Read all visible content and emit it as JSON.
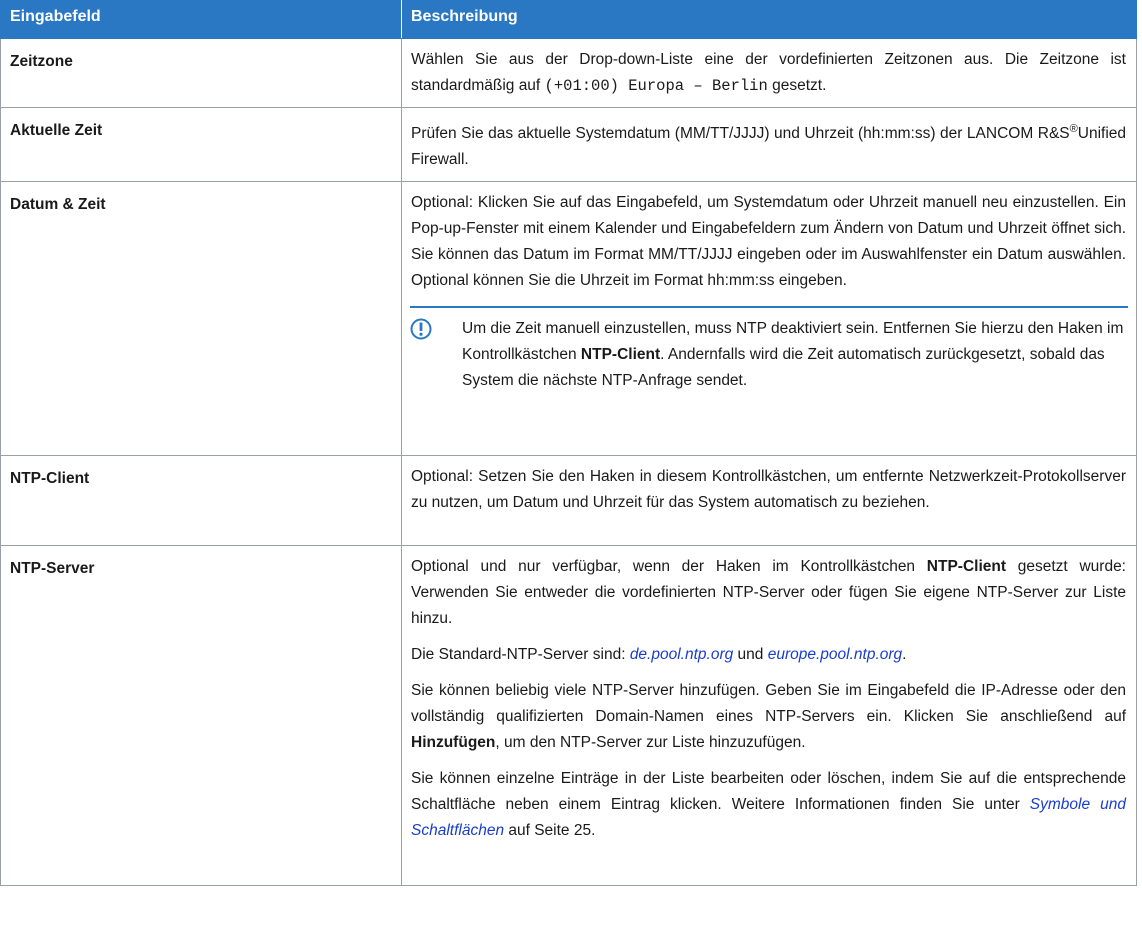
{
  "header": {
    "col1": "Eingabefeld",
    "col2": "Beschreibung"
  },
  "rows": [
    {
      "field": "Zeitzone",
      "p1_pre": "Wählen Sie aus der Drop-down-Liste eine der vordefinierten Zeitzonen aus. Die Zeitzone ist standardmäßig auf ",
      "p1_code": "(+01:00) Europa – Berlin",
      "p1_post": " gesetzt."
    },
    {
      "field": "Aktuelle Zeit",
      "p1_pre": "Prüfen Sie das aktuelle Systemdatum (MM/TT/JJJJ) und Uhrzeit (hh:mm:ss) der LANCOM R&S",
      "p1_sup": "®",
      "p1_post": "Unified Firewall."
    },
    {
      "field": "Datum & Zeit",
      "p1": "Optional: Klicken Sie auf das Eingabefeld, um Systemdatum oder Uhrzeit manuell neu einzustellen. Ein Pop-up-Fenster mit einem Kalender und Eingabefeldern zum Ändern von Datum und Uhrzeit öffnet sich. Sie können das Datum im Format MM/TT/JJJJ eingeben oder im Auswahlfenster ein Datum auswählen. Optional können Sie die Uhrzeit im Format hh:mm:ss eingeben.",
      "note_pre": "Um die Zeit manuell einzustellen, muss NTP deaktiviert sein. Entfernen Sie hierzu den Haken im Kontrollkästchen ",
      "note_bold": "NTP-Client",
      "note_post": ". Andernfalls wird die Zeit automatisch zurückgesetzt, sobald das System die nächste NTP-Anfrage sendet."
    },
    {
      "field": "NTP-Client",
      "p1": "Optional: Setzen Sie den Haken in diesem Kontrollkästchen, um entfernte Netzwerkzeit-Protokollserver zu nutzen, um Datum und Uhrzeit für das System automatisch zu beziehen."
    },
    {
      "field": "NTP-Server",
      "p1_pre": "Optional und nur verfügbar, wenn der Haken im Kontrollkästchen ",
      "p1_bold": "NTP-Client",
      "p1_post": " gesetzt wurde: Verwenden Sie entweder die vordefinierten NTP-Server oder fügen Sie eigene NTP-Server zur Liste hinzu.",
      "p2_pre": "Die Standard-NTP-Server sind: ",
      "p2_link1": "de.pool.ntp.org",
      "p2_mid": " und ",
      "p2_link2": "europe.pool.ntp.org",
      "p2_post": ".",
      "p3_pre": "Sie können beliebig viele NTP-Server hinzufügen. Geben Sie im Eingabefeld die IP-Adresse oder den vollständig qualifizierten Domain-Namen eines NTP-Servers ein. Klicken Sie anschließend auf ",
      "p3_bold": "Hinzufügen",
      "p3_post": ", um den NTP-Server zur Liste hinzuzufügen.",
      "p4_pre": "Sie können einzelne Einträge in der Liste bearbeiten oder löschen, indem Sie auf die entsprechende Schaltfläche neben einem Eintrag klicken. Weitere Informationen finden Sie unter ",
      "p4_link": "Symbole und Schaltflächen",
      "p4_post": " auf Seite 25."
    }
  ],
  "colors": {
    "header_bg": "#2a78c4",
    "link": "#1a3ccc",
    "note_icon": "#2a78c4"
  },
  "icons": {
    "note": "info-exclamation-icon"
  }
}
